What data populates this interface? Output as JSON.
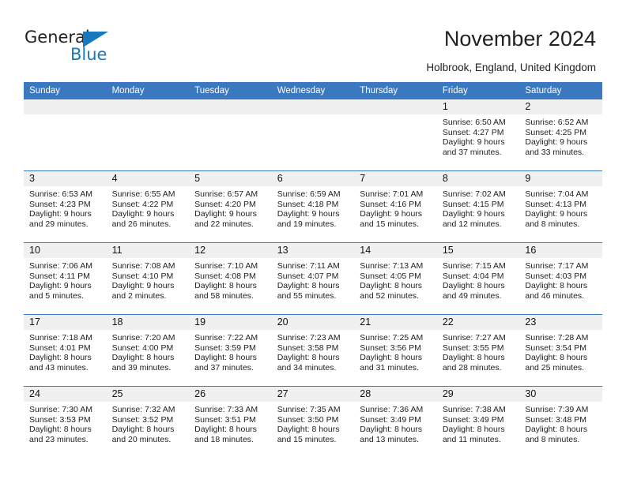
{
  "brand": {
    "name_part1": "General",
    "name_part2": "Blue",
    "accent_color": "#1878be",
    "logo_icon": "triangle-logo-icon"
  },
  "header": {
    "title": "November 2024",
    "subtitle": "Holbrook, England, United Kingdom"
  },
  "calendar": {
    "header_bg": "#3a78bf",
    "daynum_bg": "#f0f0f0",
    "weekdays": [
      "Sunday",
      "Monday",
      "Tuesday",
      "Wednesday",
      "Thursday",
      "Friday",
      "Saturday"
    ],
    "weeks": [
      [
        {
          "day": "",
          "sunrise": "",
          "sunset": "",
          "daylight1": "",
          "daylight2": "",
          "empty": true
        },
        {
          "day": "",
          "sunrise": "",
          "sunset": "",
          "daylight1": "",
          "daylight2": "",
          "empty": true
        },
        {
          "day": "",
          "sunrise": "",
          "sunset": "",
          "daylight1": "",
          "daylight2": "",
          "empty": true
        },
        {
          "day": "",
          "sunrise": "",
          "sunset": "",
          "daylight1": "",
          "daylight2": "",
          "empty": true
        },
        {
          "day": "",
          "sunrise": "",
          "sunset": "",
          "daylight1": "",
          "daylight2": "",
          "empty": true
        },
        {
          "day": "1",
          "sunrise": "Sunrise: 6:50 AM",
          "sunset": "Sunset: 4:27 PM",
          "daylight1": "Daylight: 9 hours",
          "daylight2": "and 37 minutes.",
          "empty": false
        },
        {
          "day": "2",
          "sunrise": "Sunrise: 6:52 AM",
          "sunset": "Sunset: 4:25 PM",
          "daylight1": "Daylight: 9 hours",
          "daylight2": "and 33 minutes.",
          "empty": false
        }
      ],
      [
        {
          "day": "3",
          "sunrise": "Sunrise: 6:53 AM",
          "sunset": "Sunset: 4:23 PM",
          "daylight1": "Daylight: 9 hours",
          "daylight2": "and 29 minutes.",
          "empty": false
        },
        {
          "day": "4",
          "sunrise": "Sunrise: 6:55 AM",
          "sunset": "Sunset: 4:22 PM",
          "daylight1": "Daylight: 9 hours",
          "daylight2": "and 26 minutes.",
          "empty": false
        },
        {
          "day": "5",
          "sunrise": "Sunrise: 6:57 AM",
          "sunset": "Sunset: 4:20 PM",
          "daylight1": "Daylight: 9 hours",
          "daylight2": "and 22 minutes.",
          "empty": false
        },
        {
          "day": "6",
          "sunrise": "Sunrise: 6:59 AM",
          "sunset": "Sunset: 4:18 PM",
          "daylight1": "Daylight: 9 hours",
          "daylight2": "and 19 minutes.",
          "empty": false
        },
        {
          "day": "7",
          "sunrise": "Sunrise: 7:01 AM",
          "sunset": "Sunset: 4:16 PM",
          "daylight1": "Daylight: 9 hours",
          "daylight2": "and 15 minutes.",
          "empty": false
        },
        {
          "day": "8",
          "sunrise": "Sunrise: 7:02 AM",
          "sunset": "Sunset: 4:15 PM",
          "daylight1": "Daylight: 9 hours",
          "daylight2": "and 12 minutes.",
          "empty": false
        },
        {
          "day": "9",
          "sunrise": "Sunrise: 7:04 AM",
          "sunset": "Sunset: 4:13 PM",
          "daylight1": "Daylight: 9 hours",
          "daylight2": "and 8 minutes.",
          "empty": false
        }
      ],
      [
        {
          "day": "10",
          "sunrise": "Sunrise: 7:06 AM",
          "sunset": "Sunset: 4:11 PM",
          "daylight1": "Daylight: 9 hours",
          "daylight2": "and 5 minutes.",
          "empty": false
        },
        {
          "day": "11",
          "sunrise": "Sunrise: 7:08 AM",
          "sunset": "Sunset: 4:10 PM",
          "daylight1": "Daylight: 9 hours",
          "daylight2": "and 2 minutes.",
          "empty": false
        },
        {
          "day": "12",
          "sunrise": "Sunrise: 7:10 AM",
          "sunset": "Sunset: 4:08 PM",
          "daylight1": "Daylight: 8 hours",
          "daylight2": "and 58 minutes.",
          "empty": false
        },
        {
          "day": "13",
          "sunrise": "Sunrise: 7:11 AM",
          "sunset": "Sunset: 4:07 PM",
          "daylight1": "Daylight: 8 hours",
          "daylight2": "and 55 minutes.",
          "empty": false
        },
        {
          "day": "14",
          "sunrise": "Sunrise: 7:13 AM",
          "sunset": "Sunset: 4:05 PM",
          "daylight1": "Daylight: 8 hours",
          "daylight2": "and 52 minutes.",
          "empty": false
        },
        {
          "day": "15",
          "sunrise": "Sunrise: 7:15 AM",
          "sunset": "Sunset: 4:04 PM",
          "daylight1": "Daylight: 8 hours",
          "daylight2": "and 49 minutes.",
          "empty": false
        },
        {
          "day": "16",
          "sunrise": "Sunrise: 7:17 AM",
          "sunset": "Sunset: 4:03 PM",
          "daylight1": "Daylight: 8 hours",
          "daylight2": "and 46 minutes.",
          "empty": false
        }
      ],
      [
        {
          "day": "17",
          "sunrise": "Sunrise: 7:18 AM",
          "sunset": "Sunset: 4:01 PM",
          "daylight1": "Daylight: 8 hours",
          "daylight2": "and 43 minutes.",
          "empty": false
        },
        {
          "day": "18",
          "sunrise": "Sunrise: 7:20 AM",
          "sunset": "Sunset: 4:00 PM",
          "daylight1": "Daylight: 8 hours",
          "daylight2": "and 39 minutes.",
          "empty": false
        },
        {
          "day": "19",
          "sunrise": "Sunrise: 7:22 AM",
          "sunset": "Sunset: 3:59 PM",
          "daylight1": "Daylight: 8 hours",
          "daylight2": "and 37 minutes.",
          "empty": false
        },
        {
          "day": "20",
          "sunrise": "Sunrise: 7:23 AM",
          "sunset": "Sunset: 3:58 PM",
          "daylight1": "Daylight: 8 hours",
          "daylight2": "and 34 minutes.",
          "empty": false
        },
        {
          "day": "21",
          "sunrise": "Sunrise: 7:25 AM",
          "sunset": "Sunset: 3:56 PM",
          "daylight1": "Daylight: 8 hours",
          "daylight2": "and 31 minutes.",
          "empty": false
        },
        {
          "day": "22",
          "sunrise": "Sunrise: 7:27 AM",
          "sunset": "Sunset: 3:55 PM",
          "daylight1": "Daylight: 8 hours",
          "daylight2": "and 28 minutes.",
          "empty": false
        },
        {
          "day": "23",
          "sunrise": "Sunrise: 7:28 AM",
          "sunset": "Sunset: 3:54 PM",
          "daylight1": "Daylight: 8 hours",
          "daylight2": "and 25 minutes.",
          "empty": false
        }
      ],
      [
        {
          "day": "24",
          "sunrise": "Sunrise: 7:30 AM",
          "sunset": "Sunset: 3:53 PM",
          "daylight1": "Daylight: 8 hours",
          "daylight2": "and 23 minutes.",
          "empty": false
        },
        {
          "day": "25",
          "sunrise": "Sunrise: 7:32 AM",
          "sunset": "Sunset: 3:52 PM",
          "daylight1": "Daylight: 8 hours",
          "daylight2": "and 20 minutes.",
          "empty": false
        },
        {
          "day": "26",
          "sunrise": "Sunrise: 7:33 AM",
          "sunset": "Sunset: 3:51 PM",
          "daylight1": "Daylight: 8 hours",
          "daylight2": "and 18 minutes.",
          "empty": false
        },
        {
          "day": "27",
          "sunrise": "Sunrise: 7:35 AM",
          "sunset": "Sunset: 3:50 PM",
          "daylight1": "Daylight: 8 hours",
          "daylight2": "and 15 minutes.",
          "empty": false
        },
        {
          "day": "28",
          "sunrise": "Sunrise: 7:36 AM",
          "sunset": "Sunset: 3:49 PM",
          "daylight1": "Daylight: 8 hours",
          "daylight2": "and 13 minutes.",
          "empty": false
        },
        {
          "day": "29",
          "sunrise": "Sunrise: 7:38 AM",
          "sunset": "Sunset: 3:49 PM",
          "daylight1": "Daylight: 8 hours",
          "daylight2": "and 11 minutes.",
          "empty": false
        },
        {
          "day": "30",
          "sunrise": "Sunrise: 7:39 AM",
          "sunset": "Sunset: 3:48 PM",
          "daylight1": "Daylight: 8 hours",
          "daylight2": "and 8 minutes.",
          "empty": false
        }
      ]
    ]
  }
}
